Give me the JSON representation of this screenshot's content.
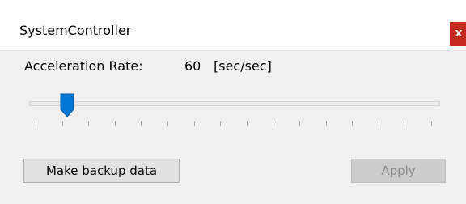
{
  "window": {
    "title": "SystemController",
    "close_label": "x"
  },
  "acceleration": {
    "label": "Acceleration Rate:",
    "value": "60",
    "unit": "[sec/sec]"
  },
  "slider": {
    "position_fraction": 0.08,
    "tick_count": 16,
    "accent_color": "#0078d7"
  },
  "buttons": {
    "backup_label": "Make backup data",
    "apply_label": "Apply",
    "apply_enabled": false
  }
}
